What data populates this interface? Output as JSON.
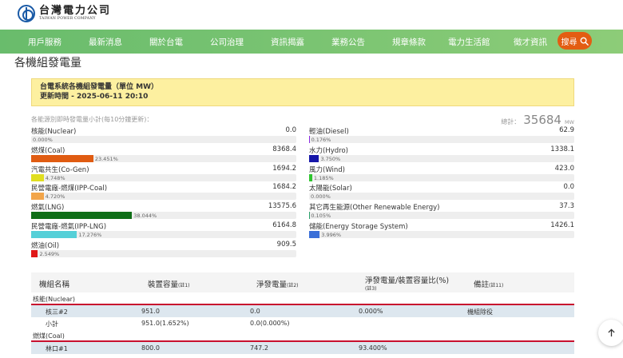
{
  "brand": {
    "name_cn": "台灣電力公司",
    "name_en": "TAIWAN POWER COMPANY"
  },
  "nav": {
    "items": [
      "用戶服務",
      "最新消息",
      "關於台電",
      "公司治理",
      "資訊揭露",
      "業務公告",
      "規章條款",
      "電力生活館",
      "徵才資訊"
    ],
    "search_label": "搜尋"
  },
  "page": {
    "title": "各機組發電量"
  },
  "notice": {
    "line1": "台電系統各機組發電量（單位 MW）",
    "line2": "更新時間 - 2025-06-11 20:10"
  },
  "summary": {
    "label": "各能源別即時發電量小計(每10分鐘更新)：",
    "total_label": "總計：",
    "total_value": "35684",
    "total_unit": "MW"
  },
  "energy_left": [
    {
      "name": "核能(Nuclear)",
      "value": "0.0",
      "percent": "0.000%",
      "fraction": 0.0,
      "color": "#888888"
    },
    {
      "name": "燃煤(Coal)",
      "value": "8368.4",
      "percent": "23.451%",
      "fraction": 0.23451,
      "color": "#e05c12"
    },
    {
      "name": "汽電共生(Co-Gen)",
      "value": "1694.2",
      "percent": "4.748%",
      "fraction": 0.04748,
      "color": "#e0de20"
    },
    {
      "name": "民營電廠-燃煤(IPP-Coal)",
      "value": "1684.2",
      "percent": "4.720%",
      "fraction": 0.0472,
      "color": "#f2a54a"
    },
    {
      "name": "燃氣(LNG)",
      "value": "13575.6",
      "percent": "38.044%",
      "fraction": 0.38044,
      "color": "#0f6e17"
    },
    {
      "name": "民營電廠-燃氣(IPP-LNG)",
      "value": "6164.8",
      "percent": "17.276%",
      "fraction": 0.17276,
      "color": "#55d0d8"
    },
    {
      "name": "燃油(Oil)",
      "value": "909.5",
      "percent": "2.549%",
      "fraction": 0.02549,
      "color": "#e01818"
    }
  ],
  "energy_right": [
    {
      "name": "輕油(Diesel)",
      "value": "62.9",
      "percent": "0.176%",
      "fraction": 0.00176,
      "color": "#8a2be2"
    },
    {
      "name": "水力(Hydro)",
      "value": "1338.1",
      "percent": "3.750%",
      "fraction": 0.0375,
      "color": "#1616a8"
    },
    {
      "name": "風力(Wind)",
      "value": "423.0",
      "percent": "1.185%",
      "fraction": 0.01185,
      "color": "#2ec42e"
    },
    {
      "name": "太陽能(Solar)",
      "value": "0.0",
      "percent": "0.000%",
      "fraction": 0.0,
      "color": "#f5c000"
    },
    {
      "name": "其它再生能源(Other Renewable Energy)",
      "value": "37.3",
      "percent": "0.105%",
      "fraction": 0.00105,
      "color": "#2aa06a"
    },
    {
      "name": "儲能(Energy Storage System)",
      "value": "1426.1",
      "percent": "3.996%",
      "fraction": 0.03996,
      "color": "#3a6fd8"
    }
  ],
  "table": {
    "headers": {
      "unit": "機組名稱",
      "capacity": "裝置容量",
      "capacity_note": "(註1)",
      "net": "淨發電量",
      "net_note": "(註2)",
      "ratio": "淨發電量/裝置容量比(%)",
      "ratio_note": "(註3)",
      "remark": "備註",
      "remark_note": "(註11)"
    },
    "groups": [
      {
        "name": "核能(Nuclear)",
        "rows": [
          {
            "unit": "核三#2",
            "capacity": "951.0",
            "net": "0.0",
            "ratio": "0.000%",
            "remark": "機組除役"
          },
          {
            "unit": "小計",
            "capacity": "951.0(1.652%)",
            "net": "0.0(0.000%)",
            "ratio": "",
            "remark": ""
          }
        ]
      },
      {
        "name": "燃煤(Coal)",
        "rows": [
          {
            "unit": "林口#1",
            "capacity": "800.0",
            "net": "747.2",
            "ratio": "93.400%",
            "remark": ""
          }
        ]
      }
    ]
  }
}
